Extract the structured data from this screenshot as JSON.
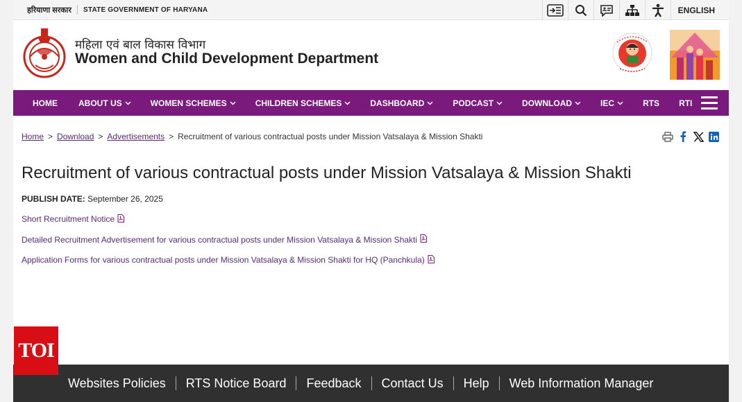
{
  "topbar": {
    "gov_hindi": "हरियाणा सरकार",
    "gov_english": "STATE GOVERNMENT OF HARYANA",
    "icons": [
      "skip-to-content-icon",
      "search-icon",
      "feedback-icon",
      "sitemap-icon",
      "accessibility-icon"
    ],
    "language": "ENGLISH"
  },
  "header": {
    "dept_hindi": "महिला एवं बाल विकास विभाग",
    "dept_english": "Women and Child Development Department"
  },
  "nav": {
    "items": [
      {
        "label": "HOME",
        "dropdown": false
      },
      {
        "label": "ABOUT US",
        "dropdown": true
      },
      {
        "label": "WOMEN SCHEMES",
        "dropdown": true
      },
      {
        "label": "CHILDREN SCHEMES",
        "dropdown": true
      },
      {
        "label": "DASHBOARD",
        "dropdown": true
      },
      {
        "label": "PODCAST",
        "dropdown": true
      },
      {
        "label": "DOWNLOAD",
        "dropdown": true
      },
      {
        "label": "IEC",
        "dropdown": true
      },
      {
        "label": "RTS",
        "dropdown": false
      },
      {
        "label": "RTI",
        "dropdown": false
      }
    ]
  },
  "breadcrumb": {
    "home": "Home",
    "download": "Download",
    "advertisements": "Advertisements",
    "current": "Recruitment of various contractual posts under Mission Vatsalaya & Mission Shakti"
  },
  "page": {
    "title": "Recruitment of various contractual posts under Mission Vatsalaya & Mission Shakti",
    "publish_label": "PUBLISH DATE:",
    "publish_date": "September 26, 2025",
    "links": [
      "Short Recruitment Notice",
      "Detailed Recruitment Advertisement for various contractual posts under Mission Vatsalaya & Mission Shakti",
      "Application Forms for various contractual posts under Mission Vatsalaya & Mission Shakti for HQ (Panchkula)"
    ]
  },
  "footer": {
    "links": [
      "Websites Policies",
      "RTS Notice Board",
      "Feedback",
      "Contact Us",
      "Help",
      "Web Information Manager"
    ]
  },
  "watermark": {
    "text": "TOI"
  },
  "colors": {
    "nav_bg": "#7b1a7d",
    "link": "#5a2a78",
    "footer_bg": "#303030",
    "toi_red": "#d90d14"
  }
}
